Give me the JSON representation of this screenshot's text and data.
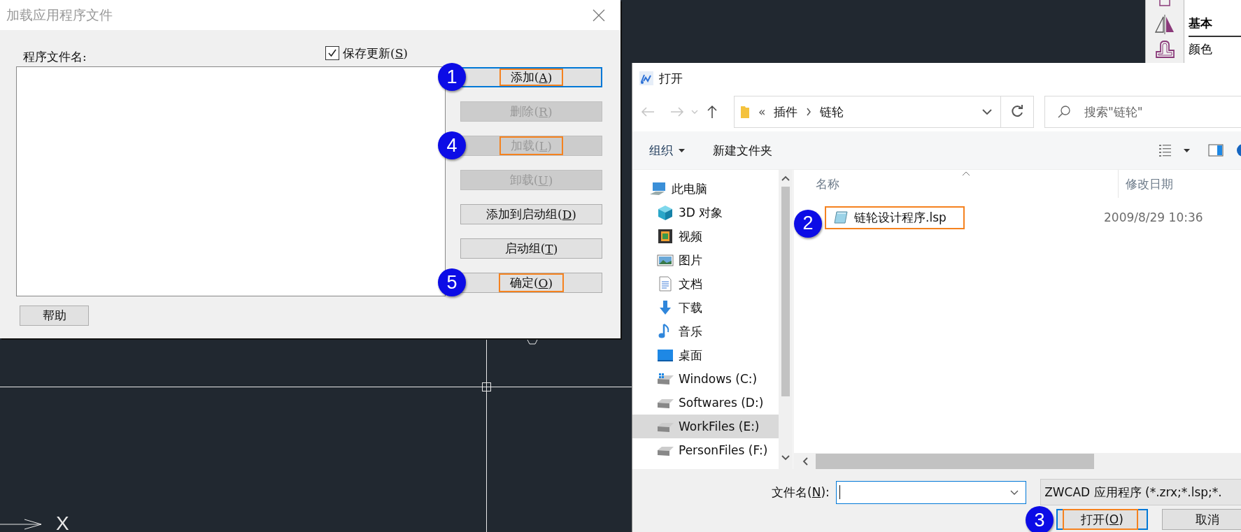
{
  "cad_canvas": {
    "axis_label": "X"
  },
  "properties_panel": {
    "section": "基本",
    "rows": [
      "颜色"
    ]
  },
  "load_dialog": {
    "title": "加载应用程序文件",
    "list_label": "程序文件名:",
    "save_updates": {
      "label": [
        "保存更新(",
        "S",
        ")"
      ],
      "checked": true
    },
    "buttons": [
      {
        "label": [
          "添加(",
          "A",
          ")"
        ],
        "disabled": false,
        "focused": true,
        "highlighted": true,
        "step": "1"
      },
      {
        "label": [
          "删除(",
          "R",
          ")"
        ],
        "disabled": true,
        "focused": false,
        "highlighted": false
      },
      {
        "label": [
          "加载(",
          "L",
          ")"
        ],
        "disabled": true,
        "focused": false,
        "highlighted": true,
        "step": "4"
      },
      {
        "label": [
          "卸载(",
          "U",
          ")"
        ],
        "disabled": true,
        "focused": false,
        "highlighted": false
      },
      {
        "label": [
          "添加到启动组(",
          "D",
          ")"
        ],
        "disabled": false,
        "focused": false,
        "highlighted": false
      },
      {
        "label": [
          "启动组(",
          "T",
          ")"
        ],
        "disabled": false,
        "focused": false,
        "highlighted": false
      },
      {
        "label": [
          "确定(",
          "O",
          ")"
        ],
        "disabled": false,
        "focused": false,
        "highlighted": true,
        "step": "5"
      }
    ],
    "help_button": "帮助"
  },
  "open_dialog": {
    "title": "打开",
    "breadcrumb": {
      "overflow": "«",
      "parts": [
        "插件",
        "链轮"
      ]
    },
    "search": {
      "placeholder": "搜索\"链轮\""
    },
    "toolbar": {
      "organize": "组织",
      "new_folder": "新建文件夹"
    },
    "nav_tree": [
      {
        "label": "此电脑",
        "kind": "pc",
        "selected": false,
        "children": [
          {
            "label": "3D 对象",
            "kind": "cube",
            "selected": false
          },
          {
            "label": "视频",
            "kind": "video",
            "selected": false
          },
          {
            "label": "图片",
            "kind": "image",
            "selected": false
          },
          {
            "label": "文档",
            "kind": "document",
            "selected": false
          },
          {
            "label": "下载",
            "kind": "download",
            "selected": false
          },
          {
            "label": "音乐",
            "kind": "music",
            "selected": false
          },
          {
            "label": "桌面",
            "kind": "desktop",
            "selected": false
          },
          {
            "label": "Windows (C:)",
            "kind": "system-drive",
            "selected": false
          },
          {
            "label": "Softwares (D:)",
            "kind": "drive",
            "selected": false
          },
          {
            "label": "WorkFiles (E:)",
            "kind": "drive",
            "selected": true
          },
          {
            "label": "PersonFiles (F:)",
            "kind": "drive",
            "selected": false
          }
        ]
      }
    ],
    "columns": [
      "名称",
      "修改日期"
    ],
    "files": [
      {
        "name": "链轮设计程序.lsp",
        "date": "2009/8/29 10:36",
        "highlighted": true,
        "step": "2"
      }
    ],
    "filename": {
      "label": [
        "文件名(",
        "N",
        "):"
      ]
    },
    "file_type": "ZWCAD 应用程序 (*.zrx;*.lsp;*.",
    "buttons": [
      {
        "label": [
          "打开(",
          "O",
          ")"
        ],
        "focused": true,
        "highlighted": true,
        "step": "3"
      },
      {
        "label": [
          "取消"
        ],
        "focused": false,
        "highlighted": false
      }
    ]
  }
}
